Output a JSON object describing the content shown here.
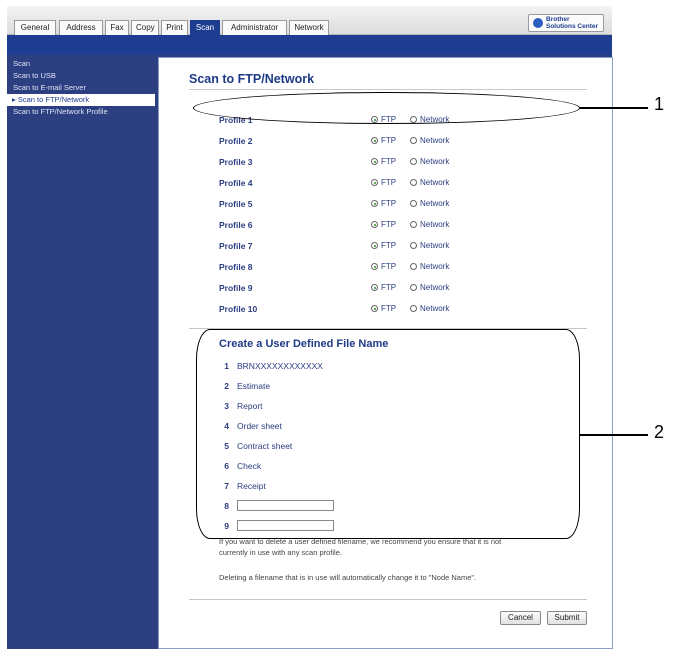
{
  "tabs": [
    "General",
    "Address",
    "Fax",
    "Copy",
    "Print",
    "Scan",
    "Administrator",
    "Network"
  ],
  "active_tab": "Scan",
  "solutions_center": "Brother\nSolutions Center",
  "sidebar": {
    "items": [
      "Scan",
      "Scan to USB",
      "Scan to E-mail Server",
      "Scan to FTP/Network",
      "Scan to FTP/Network Profile"
    ],
    "active_item": "Scan to FTP/Network"
  },
  "page_title": "Scan to FTP/Network",
  "profiles": [
    {
      "name": "Profile 1",
      "selected": "FTP"
    },
    {
      "name": "Profile 2",
      "selected": "FTP"
    },
    {
      "name": "Profile 3",
      "selected": "FTP"
    },
    {
      "name": "Profile 4",
      "selected": "FTP"
    },
    {
      "name": "Profile 5",
      "selected": "FTP"
    },
    {
      "name": "Profile 6",
      "selected": "FTP"
    },
    {
      "name": "Profile 7",
      "selected": "FTP"
    },
    {
      "name": "Profile 8",
      "selected": "FTP"
    },
    {
      "name": "Profile 9",
      "selected": "FTP"
    },
    {
      "name": "Profile 10",
      "selected": "FTP"
    }
  ],
  "radio_labels": {
    "ftp": "FTP",
    "network": "Network"
  },
  "user_file_names": {
    "title": "Create a User Defined File Name",
    "entries": [
      {
        "num": "1",
        "value": "BRNXXXXXXXXXXXX"
      },
      {
        "num": "2",
        "value": "Estimate"
      },
      {
        "num": "3",
        "value": "Report"
      },
      {
        "num": "4",
        "value": "Order sheet"
      },
      {
        "num": "5",
        "value": "Contract sheet"
      },
      {
        "num": "6",
        "value": "Check"
      },
      {
        "num": "7",
        "value": "Receipt"
      },
      {
        "num": "8",
        "value": ""
      },
      {
        "num": "9",
        "value": ""
      }
    ]
  },
  "note_lines": [
    "If you want to delete a user defined filename, we recommend you ensure that it is not",
    "currently in use with any scan profile.",
    "Deleting a filename that is in use will automatically change it to \"Node Name\"."
  ],
  "buttons": {
    "cancel": "Cancel",
    "submit": "Submit"
  },
  "callouts": [
    "1",
    "2"
  ]
}
